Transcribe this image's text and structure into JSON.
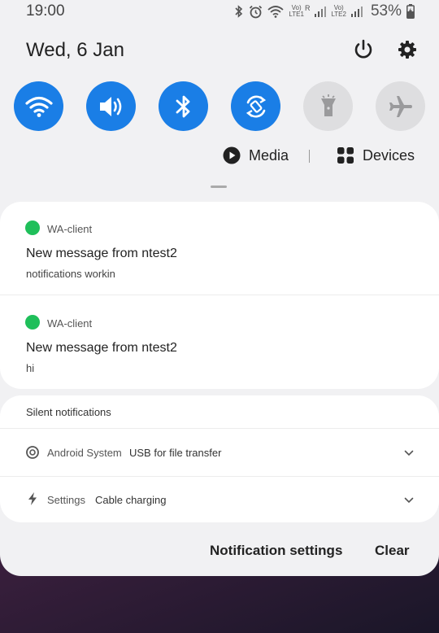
{
  "status_bar": {
    "time": "19:00",
    "sim1_volte": "Vo)",
    "sim1_r": "R",
    "sim1_lte": "LTE1",
    "sim2_volte": "Vo)",
    "sim2_lte": "LTE2",
    "battery": "53%"
  },
  "header": {
    "date": "Wed, 6 Jan"
  },
  "quick_toggles": [
    {
      "name": "wifi",
      "state": "on"
    },
    {
      "name": "sound",
      "state": "on"
    },
    {
      "name": "bluetooth",
      "state": "on"
    },
    {
      "name": "auto-rotate",
      "state": "on"
    },
    {
      "name": "flashlight",
      "state": "off"
    },
    {
      "name": "airplane-mode",
      "state": "off"
    }
  ],
  "media_row": {
    "media_label": "Media",
    "separator": "|",
    "devices_label": "Devices"
  },
  "notifications": [
    {
      "app": "WA-client",
      "title": "New message from ntest2",
      "body": "notifications workin"
    },
    {
      "app": "WA-client",
      "title": "New message from ntest2",
      "body": "hi"
    }
  ],
  "silent": {
    "header": "Silent notifications",
    "items": [
      {
        "app": "Android System",
        "text": "USB for file transfer"
      },
      {
        "app": "Settings",
        "text": "Cable charging"
      }
    ]
  },
  "footer": {
    "settings_label": "Notification settings",
    "clear_label": "Clear"
  },
  "colors": {
    "accent": "#1a7ee6",
    "app_dot": "#1fbf5a",
    "toggle_off": "#dedee0"
  }
}
